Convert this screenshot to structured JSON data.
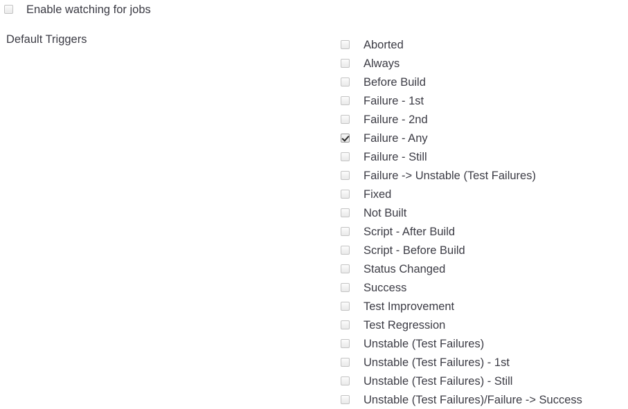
{
  "enable_watching": {
    "label": "Enable watching for jobs",
    "checked": false,
    "icon": "checkbox-icon"
  },
  "default_triggers": {
    "label": "Default Triggers",
    "items": [
      {
        "label": "Aborted",
        "checked": false
      },
      {
        "label": "Always",
        "checked": false
      },
      {
        "label": "Before Build",
        "checked": false
      },
      {
        "label": "Failure - 1st",
        "checked": false
      },
      {
        "label": "Failure - 2nd",
        "checked": false
      },
      {
        "label": "Failure - Any",
        "checked": true
      },
      {
        "label": "Failure - Still",
        "checked": false
      },
      {
        "label": "Failure -> Unstable (Test Failures)",
        "checked": false
      },
      {
        "label": "Fixed",
        "checked": false
      },
      {
        "label": "Not Built",
        "checked": false
      },
      {
        "label": "Script - After Build",
        "checked": false
      },
      {
        "label": "Script - Before Build",
        "checked": false
      },
      {
        "label": "Status Changed",
        "checked": false
      },
      {
        "label": "Success",
        "checked": false
      },
      {
        "label": "Test Improvement",
        "checked": false
      },
      {
        "label": "Test Regression",
        "checked": false
      },
      {
        "label": "Unstable (Test Failures)",
        "checked": false
      },
      {
        "label": "Unstable (Test Failures) - 1st",
        "checked": false
      },
      {
        "label": "Unstable (Test Failures) - Still",
        "checked": false
      },
      {
        "label": "Unstable (Test Failures)/Failure -> Success",
        "checked": false
      }
    ]
  },
  "colors": {
    "background": "#ffffff",
    "text": "#3b3b44",
    "checkbox_border": "#c3c3c3",
    "checkmark": "#2b2b2b"
  }
}
